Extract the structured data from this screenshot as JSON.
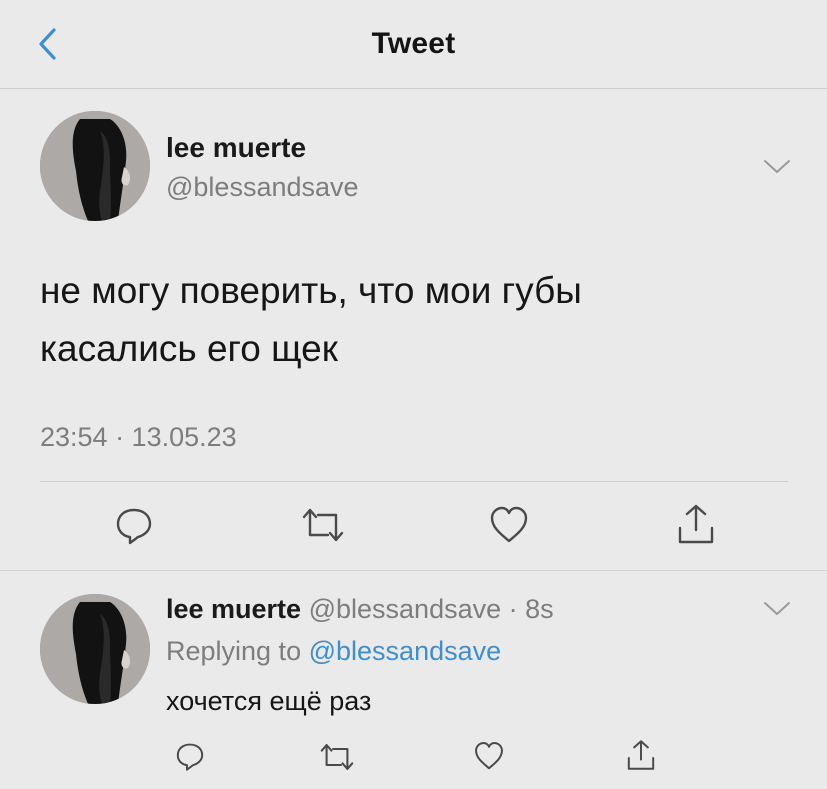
{
  "header": {
    "title": "Tweet"
  },
  "tweet": {
    "author_name": "lee muerte",
    "author_handle": "@blessandsave",
    "text_line1": "не могу поверить, что мои губы",
    "text_line2": "касались его щек",
    "timestamp": "23:54 · 13.05.23"
  },
  "reply": {
    "author_name": "lee muerte",
    "author_handle": "@blessandsave",
    "separator": "·",
    "time": "8s",
    "replying_to_label": "Replying to",
    "replying_to_handle": "@blessandsave",
    "text": "хочется ещё раз"
  },
  "icons": {
    "back": "chevron-left-icon",
    "menu": "chevron-down-icon",
    "reply": "reply-bubble-icon",
    "retweet": "retweet-icon",
    "like": "heart-icon",
    "share": "share-icon"
  },
  "colors": {
    "accent": "#3d8fd0",
    "background": "#ebeaea",
    "secondary_text": "#7d7d7d"
  }
}
